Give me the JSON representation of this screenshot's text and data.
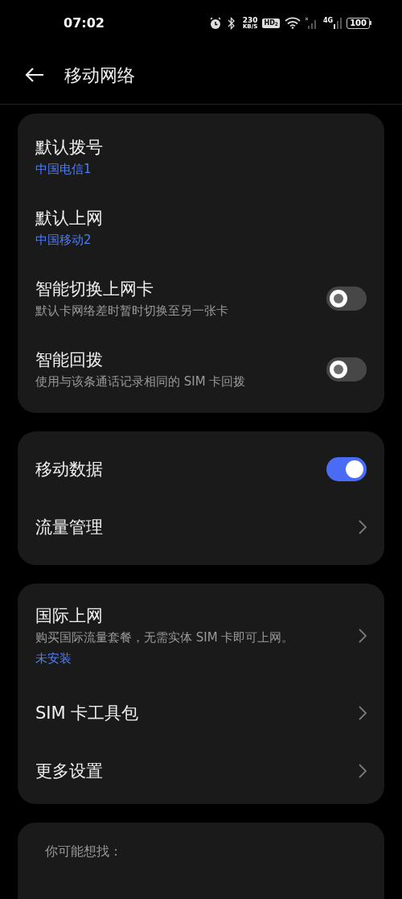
{
  "status_bar": {
    "time": "07:02",
    "speed_value": "230",
    "speed_unit": "KB/S",
    "hd_badge": "HD$_{2}$",
    "battery": "100",
    "network_type": "4G"
  },
  "header": {
    "title": "移动网络"
  },
  "cards": [
    {
      "items": [
        {
          "kind": "info",
          "title": "默认拨号",
          "subtitle": "中国电信1",
          "subtitle_accent": true
        },
        {
          "kind": "info",
          "title": "默认上网",
          "subtitle": "中国移动2",
          "subtitle_accent": true
        },
        {
          "kind": "toggle",
          "title": "智能切换上网卡",
          "subtitle": "默认卡网络差时暂时切换至另一张卡",
          "on": false
        },
        {
          "kind": "toggle",
          "title": "智能回拨",
          "subtitle": "使用与该条通话记录相同的 SIM 卡回拨",
          "on": false
        }
      ]
    },
    {
      "items": [
        {
          "kind": "toggle",
          "title": "移动数据",
          "on": true
        },
        {
          "kind": "nav",
          "title": "流量管理"
        }
      ]
    },
    {
      "items": [
        {
          "kind": "nav",
          "title": "国际上网",
          "subtitle": "购买国际流量套餐，无需实体 SIM 卡即可上网。",
          "note": "未安装"
        },
        {
          "kind": "nav",
          "title": "SIM 卡工具包"
        },
        {
          "kind": "nav",
          "title": "更多设置"
        }
      ]
    }
  ],
  "suggestions": {
    "heading": "你可能想找："
  }
}
